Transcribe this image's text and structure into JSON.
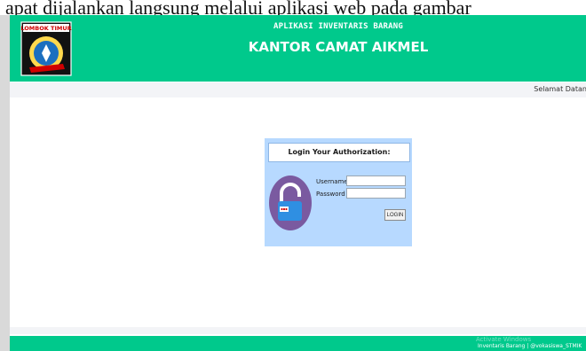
{
  "document_snippet": "apat dijalankan langsung melalui aplikasi web pada gambar",
  "header": {
    "logo_text": "LOMBOK TIMUR",
    "app_name": "APLIKASI INVENTARIS BARANG",
    "office_name": "KANTOR CAMAT AIKMEL"
  },
  "welcome": {
    "text": "Selamat Datang"
  },
  "login": {
    "title": "Login Your Authorization:",
    "username_label": "Username :",
    "password_label": "Password  :",
    "username_value": "",
    "password_value": "",
    "button_label": "LOGIN",
    "lock_icon": "padlock-icon"
  },
  "footer": {
    "watermark": "Activate Windows",
    "credits": "Inventaris Barang | @vokasiswa_STMIK"
  },
  "colors": {
    "header_green": "#00c98c",
    "panel_blue": "#b7d9ff",
    "lock_purple": "#7a5aa0",
    "lock_blue": "#2f8fe2"
  }
}
